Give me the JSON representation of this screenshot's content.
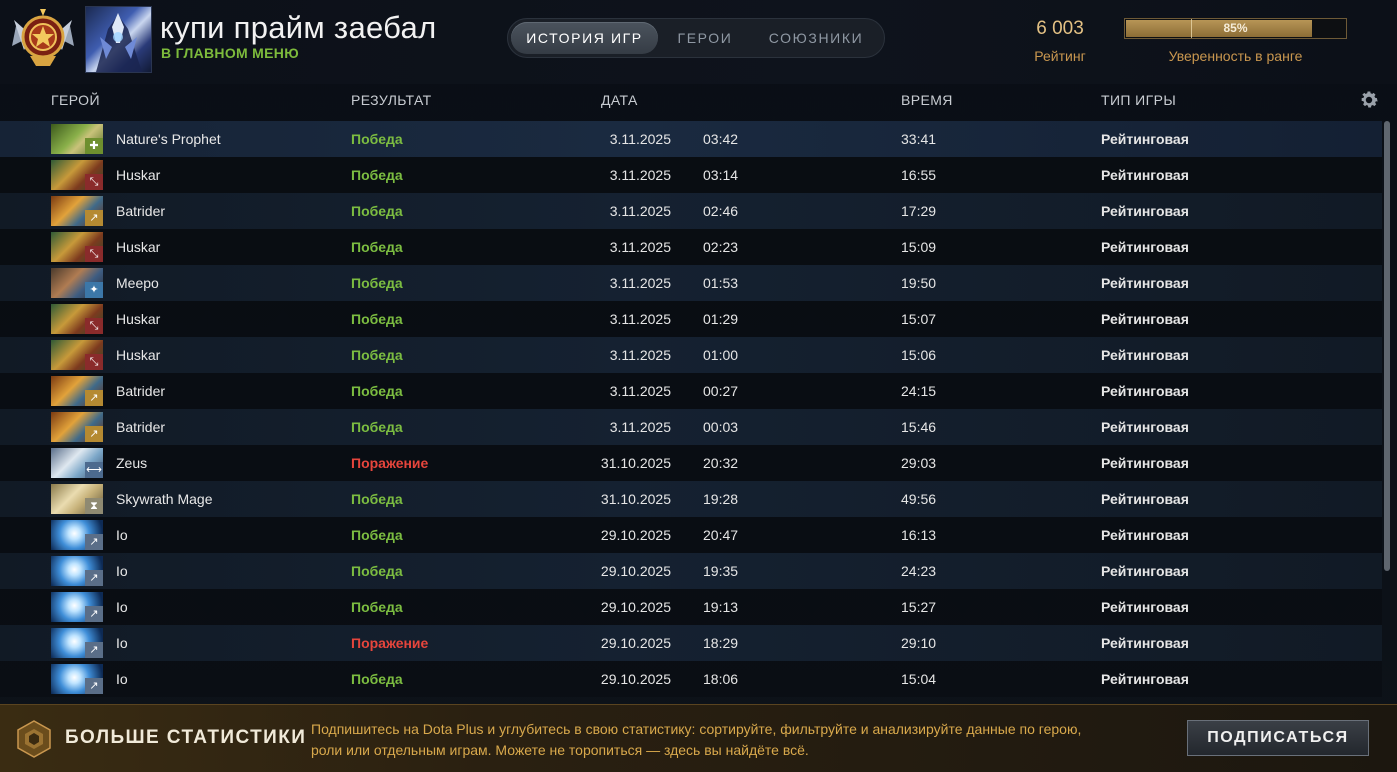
{
  "player": {
    "name": "купи прайм заебал",
    "status": "В ГЛАВНОМ МЕНЮ"
  },
  "tabs": [
    {
      "label": "ИСТОРИЯ ИГР",
      "active": true
    },
    {
      "label": "ГЕРОИ",
      "active": false
    },
    {
      "label": "СОЮЗНИКИ",
      "active": false
    }
  ],
  "rating": {
    "value": "6 003",
    "label": "Рейтинг"
  },
  "confidence": {
    "percent": 85,
    "text": "85%",
    "label": "Уверенность в ранге"
  },
  "columns": {
    "hero": "ГЕРОЙ",
    "result": "РЕЗУЛЬТАТ",
    "date": "ДАТА",
    "duration": "ВРЕМЯ",
    "type": "ТИП ИГРЫ"
  },
  "matches": [
    {
      "hero": "Nature's Prophet",
      "result": "Победа",
      "win": true,
      "date": "3.11.2025",
      "time": "03:42",
      "duration": "33:41",
      "type": "Рейтинговая",
      "icon": "natures-prophet",
      "role": "support"
    },
    {
      "hero": "Huskar",
      "result": "Победа",
      "win": true,
      "date": "3.11.2025",
      "time": "03:14",
      "duration": "16:55",
      "type": "Рейтинговая",
      "icon": "huskar",
      "role": "offlane"
    },
    {
      "hero": "Batrider",
      "result": "Победа",
      "win": true,
      "date": "3.11.2025",
      "time": "02:46",
      "duration": "17:29",
      "type": "Рейтинговая",
      "icon": "batrider",
      "role": "mid"
    },
    {
      "hero": "Huskar",
      "result": "Победа",
      "win": true,
      "date": "3.11.2025",
      "time": "02:23",
      "duration": "15:09",
      "type": "Рейтинговая",
      "icon": "huskar",
      "role": "offlane"
    },
    {
      "hero": "Meepo",
      "result": "Победа",
      "win": true,
      "date": "3.11.2025",
      "time": "01:53",
      "duration": "19:50",
      "type": "Рейтинговая",
      "icon": "meepo",
      "role": "jungle"
    },
    {
      "hero": "Huskar",
      "result": "Победа",
      "win": true,
      "date": "3.11.2025",
      "time": "01:29",
      "duration": "15:07",
      "type": "Рейтинговая",
      "icon": "huskar",
      "role": "offlane"
    },
    {
      "hero": "Huskar",
      "result": "Победа",
      "win": true,
      "date": "3.11.2025",
      "time": "01:00",
      "duration": "15:06",
      "type": "Рейтинговая",
      "icon": "huskar",
      "role": "offlane"
    },
    {
      "hero": "Batrider",
      "result": "Победа",
      "win": true,
      "date": "3.11.2025",
      "time": "00:27",
      "duration": "24:15",
      "type": "Рейтинговая",
      "icon": "batrider",
      "role": "mid"
    },
    {
      "hero": "Batrider",
      "result": "Победа",
      "win": true,
      "date": "3.11.2025",
      "time": "00:03",
      "duration": "15:46",
      "type": "Рейтинговая",
      "icon": "batrider",
      "role": "mid"
    },
    {
      "hero": "Zeus",
      "result": "Поражение",
      "win": false,
      "date": "31.10.2025",
      "time": "20:32",
      "duration": "29:03",
      "type": "Рейтинговая",
      "icon": "zeus",
      "role": "carry"
    },
    {
      "hero": "Skywrath Mage",
      "result": "Победа",
      "win": true,
      "date": "31.10.2025",
      "time": "19:28",
      "duration": "49:56",
      "type": "Рейтинговая",
      "icon": "skywrath-mage",
      "role": "hard-support"
    },
    {
      "hero": "Io",
      "result": "Победа",
      "win": true,
      "date": "29.10.2025",
      "time": "20:47",
      "duration": "16:13",
      "type": "Рейтинговая",
      "icon": "io",
      "role": "mid"
    },
    {
      "hero": "Io",
      "result": "Победа",
      "win": true,
      "date": "29.10.2025",
      "time": "19:35",
      "duration": "24:23",
      "type": "Рейтинговая",
      "icon": "io",
      "role": "mid"
    },
    {
      "hero": "Io",
      "result": "Победа",
      "win": true,
      "date": "29.10.2025",
      "time": "19:13",
      "duration": "15:27",
      "type": "Рейтинговая",
      "icon": "io",
      "role": "mid"
    },
    {
      "hero": "Io",
      "result": "Поражение",
      "win": false,
      "date": "29.10.2025",
      "time": "18:29",
      "duration": "29:10",
      "type": "Рейтинговая",
      "icon": "io",
      "role": "mid"
    },
    {
      "hero": "Io",
      "result": "Победа",
      "win": true,
      "date": "29.10.2025",
      "time": "18:06",
      "duration": "15:04",
      "type": "Рейтинговая",
      "icon": "io",
      "role": "mid"
    }
  ],
  "dota_plus": {
    "title": "БОЛЬШЕ СТАТИСТИКИ",
    "text": "Подпишитесь на Dota Plus и углубитесь в свою статистику: сортируйте, фильтруйте и анализируйте данные по герою, роли или отдельным играм. Можете не торопиться — здесь вы найдёте всё.",
    "button": "ПОДПИСАТЬСЯ"
  },
  "colors": {
    "win": "#7cbd41",
    "loss": "#e6453c",
    "gold": "#c9974f",
    "status": "#7dbb3c"
  }
}
